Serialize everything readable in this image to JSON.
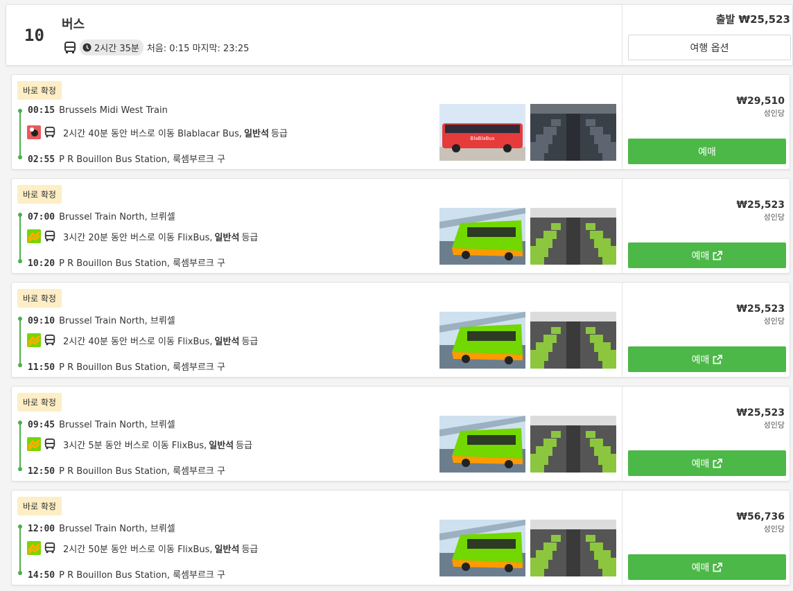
{
  "header": {
    "count": "10",
    "title": "버스",
    "duration": "2시간 35분",
    "first_last": "처음: 0:15 마지막: 23:25",
    "price": "출발 ₩25,523",
    "options_label": "여행 옵션"
  },
  "colors": {
    "accent_green": "#4cb848",
    "badge_bg": "#fdeec6",
    "flixbus_green": "#73d700",
    "blablacar_red": "#e85b5b"
  },
  "trips": [
    {
      "badge": "바로 확정",
      "dep_time": "00:15",
      "dep_station": "Brussels Midi West Train",
      "segment_pre": "2시간 40분 동안 버스로 이동 Blablacar Bus,",
      "class_name": "일반석",
      "segment_post": "등급",
      "arr_time": "02:55",
      "arr_station": "P R Bouillon Bus Station, 룩셈부르크 구",
      "operator": "blablacar",
      "price": "₩29,510",
      "per": "성인당",
      "book_label": "예매",
      "external": false
    },
    {
      "badge": "바로 확정",
      "dep_time": "07:00",
      "dep_station": "Brussel Train North, 브뤼셀",
      "segment_pre": "3시간 20분 동안 버스로 이동 FlixBus,",
      "class_name": "일반석",
      "segment_post": "등급",
      "arr_time": "10:20",
      "arr_station": "P R Bouillon Bus Station, 룩셈부르크 구",
      "operator": "flixbus",
      "price": "₩25,523",
      "per": "성인당",
      "book_label": "예매",
      "external": true
    },
    {
      "badge": "바로 확정",
      "dep_time": "09:10",
      "dep_station": "Brussel Train North, 브뤼셀",
      "segment_pre": "2시간 40분 동안 버스로 이동 FlixBus,",
      "class_name": "일반석",
      "segment_post": "등급",
      "arr_time": "11:50",
      "arr_station": "P R Bouillon Bus Station, 룩셈부르크 구",
      "operator": "flixbus",
      "price": "₩25,523",
      "per": "성인당",
      "book_label": "예매",
      "external": true
    },
    {
      "badge": "바로 확정",
      "dep_time": "09:45",
      "dep_station": "Brussel Train North, 브뤼셀",
      "segment_pre": "3시간 5분 동안 버스로 이동 FlixBus,",
      "class_name": "일반석",
      "segment_post": "등급",
      "arr_time": "12:50",
      "arr_station": "P R Bouillon Bus Station, 룩셈부르크 구",
      "operator": "flixbus",
      "price": "₩25,523",
      "per": "성인당",
      "book_label": "예매",
      "external": true
    },
    {
      "badge": "바로 확정",
      "dep_time": "12:00",
      "dep_station": "Brussel Train North, 브뤼셀",
      "segment_pre": "2시간 50분 동안 버스로 이동 FlixBus,",
      "class_name": "일반석",
      "segment_post": "등급",
      "arr_time": "14:50",
      "arr_station": "P R Bouillon Bus Station, 룩셈부르크 구",
      "operator": "flixbus",
      "price": "₩56,736",
      "per": "성인당",
      "book_label": "예매",
      "external": true
    }
  ]
}
